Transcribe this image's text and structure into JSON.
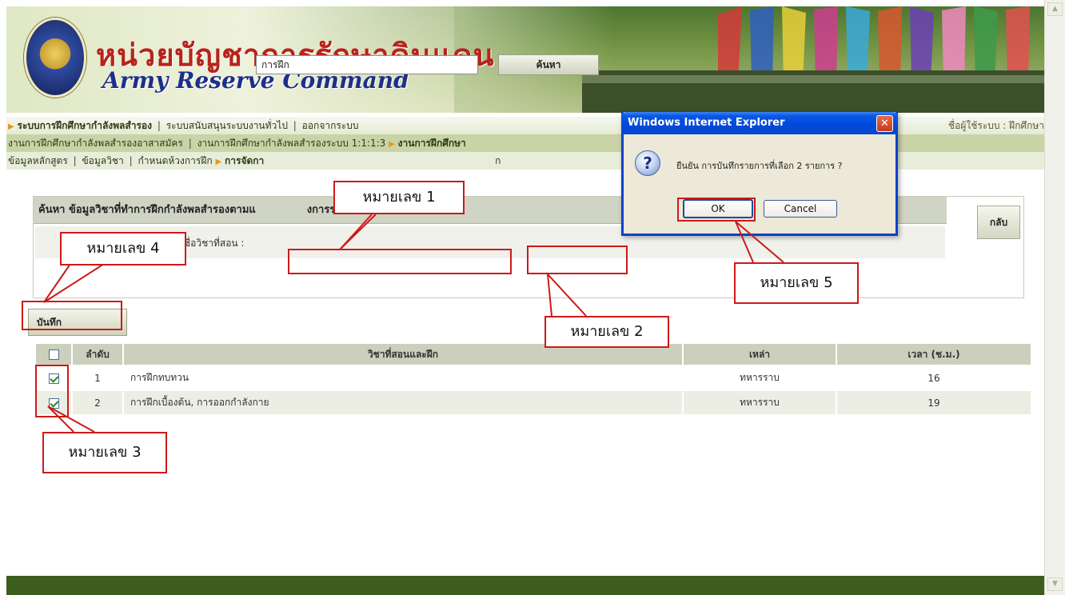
{
  "banner": {
    "title_th": "หน่วยบัญชาการรักษาดินแดน",
    "title_en": "Army Reserve Command"
  },
  "nav1": {
    "item1": "ระบบการฝึกศึกษากำลังพลสำรอง",
    "item2": "ระบบสนับสนุนระบบงานทั่วไป",
    "item3": "ออกจากระบบ",
    "sep": "|",
    "user": "ชื่อผู้ใช้ระบบ : ฝึกศึกษา"
  },
  "nav2": {
    "item1": "งานการฝึกศึกษากำลังพลสำรองอาสาสมัคร",
    "item2": "งานการฝึกศึกษากำลังพลสำรองระบบ 1:1:1:3",
    "item3": "งานการฝึกศึกษา"
  },
  "nav3": {
    "item1": "ข้อมูลหลักสูตร",
    "item2": "ข้อมูลวิชา",
    "item3": "กำหนดห้วงการฝึก",
    "item4": "การจัดกา",
    "item5": "ก"
  },
  "search": {
    "header": "ค้นหา ข้อมูลวิชาที่ทำการฝึกกำลังพลสำรองตามแ",
    "header_tail": "งการรบราชการ",
    "label": "ชื่อวิชาที่สอน :",
    "value": "การฝึก",
    "button": "ค้นหา",
    "back": "กลับ"
  },
  "save_button": "บันทึก",
  "table": {
    "headers": {
      "order": "ลำดับ",
      "subject": "วิชาที่สอนและฝึก",
      "branch": "เหล่า",
      "time": "เวลา (ช.ม.)"
    },
    "rows": [
      {
        "order": "1",
        "subject": "การฝึกทบทวน",
        "branch": "ทหารราบ",
        "time": "16",
        "checked": true
      },
      {
        "order": "2",
        "subject": "การฝึกเบื้องต้น, การออกกำลังกาย",
        "branch": "ทหารราบ",
        "time": "19",
        "checked": true
      }
    ]
  },
  "dialog": {
    "title": "Windows Internet Explorer",
    "close": "✕",
    "icon": "?",
    "message": "ยืนยัน การบันทึกรายการที่เลือก 2 รายการ ?",
    "ok": "OK",
    "cancel": "Cancel"
  },
  "annotations": {
    "n1": "หมายเลข 1",
    "n2": "หมายเลข 2",
    "n3": "หมายเลข 3",
    "n4": "หมายเลข 4",
    "n5": "หมายเลข 5"
  },
  "colors": {
    "banner_green": "#3f6a24",
    "footer_green": "#3d5d1f",
    "annotation_red": "#cc1a1a",
    "dialog_blue": "#0048dc"
  },
  "icons": [
    "army-emblem-icon",
    "question-icon",
    "close-icon",
    "checkbox-icon",
    "arrow-right-icon",
    "scroll-up-icon",
    "scroll-down-icon"
  ]
}
